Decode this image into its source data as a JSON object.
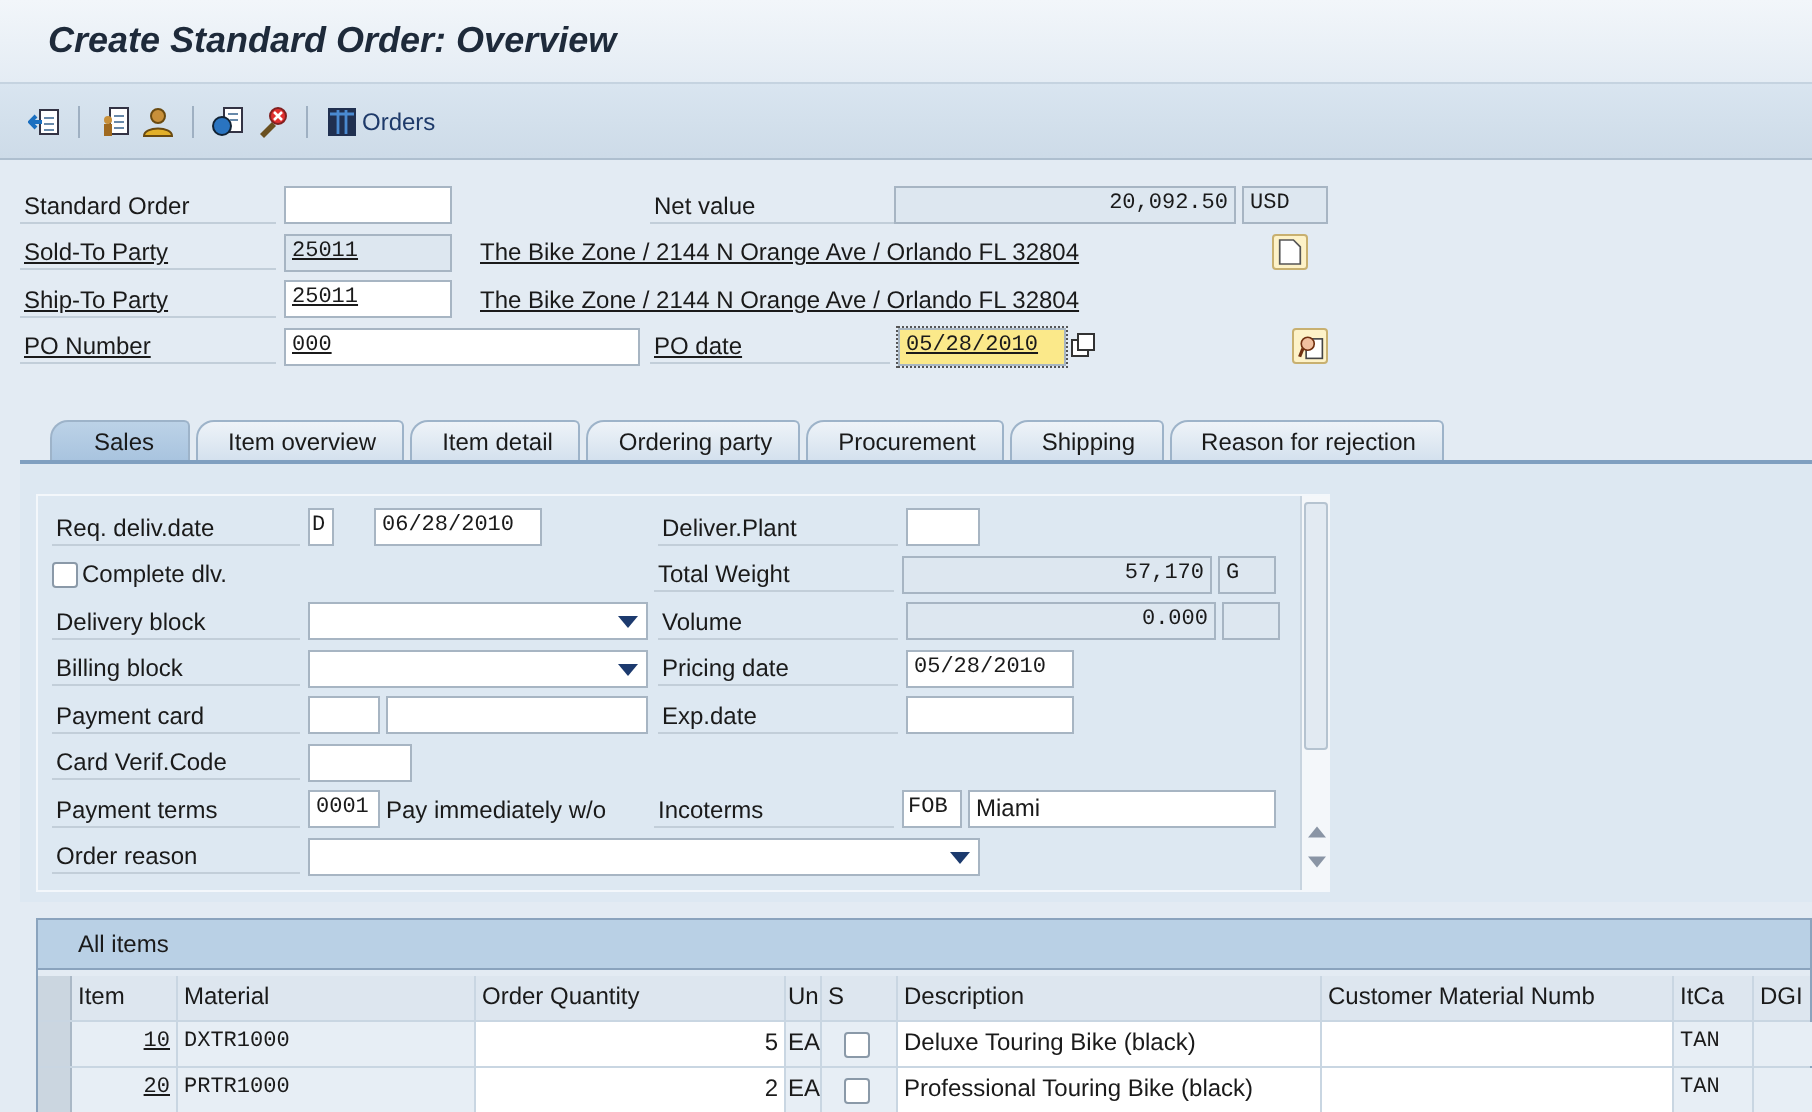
{
  "window": {
    "title": "Create Standard Order: Overview"
  },
  "toolbar": {
    "orders_label": "Orders"
  },
  "header": {
    "standard_order": {
      "label": "Standard Order"
    },
    "net_value": {
      "label": "Net value",
      "value": "20,092.50",
      "currency": "USD"
    },
    "sold_to": {
      "label": "Sold-To Party",
      "value": "25011",
      "address": "The Bike Zone / 2144 N Orange Ave / Orlando FL 32804"
    },
    "ship_to": {
      "label": "Ship-To Party",
      "value": "25011",
      "address": "The Bike Zone / 2144 N Orange Ave / Orlando FL 32804"
    },
    "po_number": {
      "label": "PO Number",
      "value": "000"
    },
    "po_date": {
      "label": "PO date",
      "value": "05/28/2010"
    }
  },
  "tabs": [
    {
      "label": "Sales",
      "selected": true
    },
    {
      "label": "Item overview",
      "selected": false
    },
    {
      "label": "Item detail",
      "selected": false
    },
    {
      "label": "Ordering party",
      "selected": false
    },
    {
      "label": "Procurement",
      "selected": false
    },
    {
      "label": "Shipping",
      "selected": false
    },
    {
      "label": "Reason for rejection",
      "selected": false
    }
  ],
  "sales": {
    "req_deliv_date": {
      "label": "Req. deliv.date",
      "type": "D",
      "value": "06/28/2010"
    },
    "deliver_plant": {
      "label": "Deliver.Plant"
    },
    "complete_dlv": {
      "label": "Complete dlv.",
      "checked": false
    },
    "total_weight": {
      "label": "Total Weight",
      "value": "57,170",
      "unit": "G"
    },
    "delivery_block": {
      "label": "Delivery block"
    },
    "volume": {
      "label": "Volume",
      "value": "0.000"
    },
    "billing_block": {
      "label": "Billing block"
    },
    "pricing_date": {
      "label": "Pricing date",
      "value": "05/28/2010"
    },
    "payment_card": {
      "label": "Payment card"
    },
    "exp_date": {
      "label": "Exp.date"
    },
    "card_verif_code": {
      "label": "Card Verif.Code"
    },
    "payment_terms": {
      "label": "Payment terms",
      "value": "0001",
      "description": "Pay immediately w/o"
    },
    "incoterms": {
      "label": "Incoterms",
      "code": "FOB",
      "place": "Miami"
    },
    "order_reason": {
      "label": "Order reason"
    }
  },
  "items_table": {
    "title": "All items",
    "columns": [
      "Item",
      "Material",
      "Order Quantity",
      "Un",
      "S",
      "Description",
      "Customer Material Numb",
      "ItCa",
      "DGI"
    ],
    "rows": [
      {
        "item": "10",
        "material": "DXTR1000",
        "quantity": "5",
        "unit": "EA",
        "checked": false,
        "description": "Deluxe Touring Bike (black)",
        "item_category": "TAN"
      },
      {
        "item": "20",
        "material": "PRTR1000",
        "quantity": "2",
        "unit": "EA",
        "checked": false,
        "description": "Professional Touring Bike (black)",
        "item_category": "TAN"
      }
    ]
  }
}
